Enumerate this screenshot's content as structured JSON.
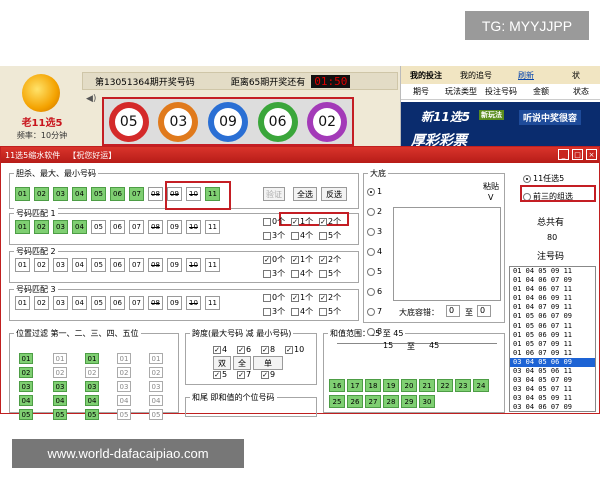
{
  "watermark_tg": "TG: MYYJJPP",
  "watermark_site": "www.world-dafacaipiao.com",
  "logo": {
    "name": "老11选5",
    "freq": "频率：10分钟"
  },
  "draw": {
    "issue_text": "第13051364期开奖号码",
    "countdown_text": "距离65期开奖还有",
    "clock": "01:50",
    "balls": [
      "05",
      "03",
      "09",
      "06",
      "02"
    ],
    "ball_colors": [
      "#d42a2a",
      "#e07a1c",
      "#2a6fd4",
      "#3aa63a",
      "#a33ab8"
    ]
  },
  "right_panel": {
    "tabs": [
      "我的投注",
      "我的追号",
      "刷新",
      "状"
    ],
    "cols": [
      "期号",
      "玩法类型",
      "投注号码",
      "金额",
      "状态"
    ],
    "banner1": "新11选5",
    "banner1b": "新玩法",
    "banner2": "听说中奖很容",
    "banner3": "厚彩彩票"
  },
  "window": {
    "title": "11选5缩水软件",
    "subtitle": "【祝您好运】",
    "btn_min": "_",
    "btn_max": "□",
    "btn_close": "×"
  },
  "kill": {
    "label": "胆杀、最大、最小号码",
    "nums": [
      "01",
      "02",
      "03",
      "04",
      "05",
      "06",
      "07",
      "08",
      "09",
      "10",
      "11"
    ],
    "btn_verify": "验证",
    "btn_all": "全选",
    "btn_invert": "反选"
  },
  "match1": {
    "label": "号码匹配 1",
    "nums": [
      "01",
      "02",
      "03",
      "04",
      "05",
      "06",
      "07",
      "08",
      "09",
      "10",
      "11"
    ],
    "checks": [
      "0个",
      "1个",
      "2个",
      "3个",
      "4个",
      "5个"
    ]
  },
  "match2": {
    "label": "号码匹配 2",
    "nums": [
      "01",
      "02",
      "03",
      "04",
      "05",
      "06",
      "07",
      "08",
      "09",
      "10",
      "11"
    ],
    "checks": [
      "0个",
      "1个",
      "2个",
      "3个",
      "4个",
      "5个"
    ]
  },
  "match3": {
    "label": "号码匹配 3",
    "nums": [
      "01",
      "02",
      "03",
      "04",
      "05",
      "06",
      "07",
      "08",
      "09",
      "10",
      "11"
    ],
    "checks": [
      "0个",
      "1个",
      "2个",
      "3个",
      "4个",
      "5个"
    ]
  },
  "dadi": {
    "label": "大底",
    "paste": "粘贴",
    "v": "V",
    "opts": [
      "1",
      "2",
      "3",
      "4",
      "5",
      "6",
      "7",
      "8"
    ],
    "tol_label": "大底容错：",
    "tol_from": "0",
    "tol_to_label": "至",
    "tol_to": "0"
  },
  "mode": {
    "opt1": "11任选5",
    "opt2": "前三的组选",
    "total_label": "总共有",
    "total": "80",
    "notes_label": "注号码"
  },
  "results": [
    "01 04 05 09 11",
    "01 04 06 07 09",
    "01 04 06 07 11",
    "01 04 06 09 11",
    "01 04 07 09 11",
    "01 05 06 07 09",
    "01 05 06 07 11",
    "01 05 06 09 11",
    "01 05 07 09 11",
    "01 06 07 09 11",
    "03 04 05 06 09",
    "03 04 05 06 11",
    "03 04 05 07 09",
    "03 04 05 07 11",
    "03 04 05 09 11",
    "03 04 06 07 09"
  ],
  "position": {
    "label": "位置过滤 第一、二、三、四、五位"
  },
  "span": {
    "label": "跨度(最大号码 减 最小号码)",
    "vals": [
      "4",
      "6",
      "8",
      "10"
    ],
    "btns": [
      "双",
      "全",
      "单"
    ],
    "vals2": [
      "5",
      "7",
      "9"
    ]
  },
  "sum": {
    "label": "和值范围：15 至 45",
    "from": "15",
    "to_label": "至",
    "to": "45",
    "nums": [
      "16",
      "17",
      "18",
      "19",
      "20",
      "21",
      "22",
      "23",
      "24",
      "25",
      "26",
      "27",
      "28",
      "29",
      "30"
    ]
  },
  "tail": {
    "label": "和尾 即和值的个位号码"
  }
}
